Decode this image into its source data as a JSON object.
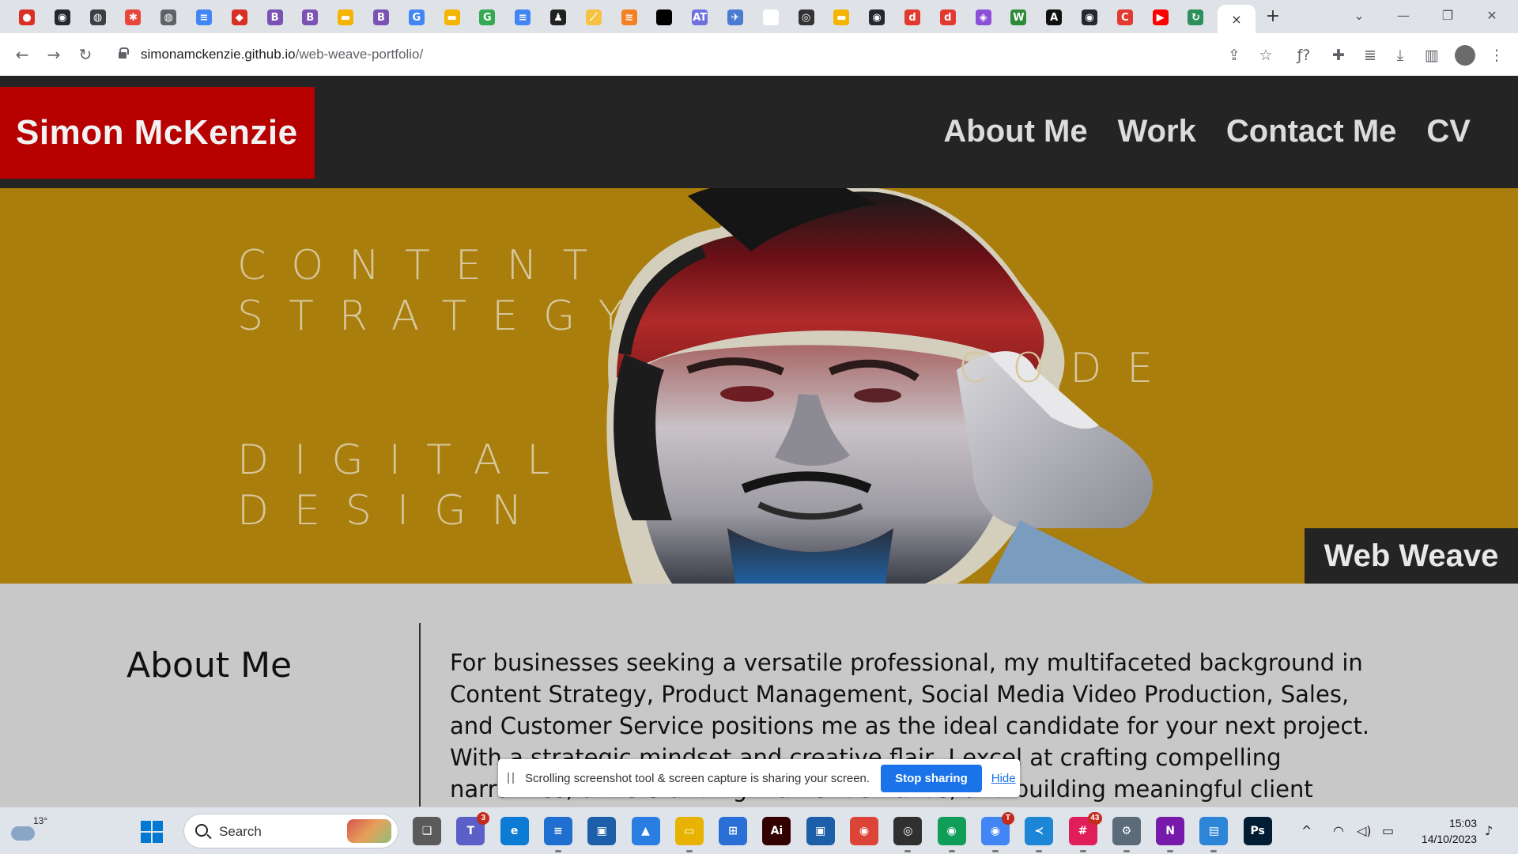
{
  "browser": {
    "tabs": [
      {
        "icon": "record-icon",
        "color": "#d93025",
        "glyph": "●"
      },
      {
        "icon": "github-icon",
        "color": "#24292f",
        "glyph": "◉"
      },
      {
        "icon": "globe-icon",
        "color": "#3c4043",
        "glyph": "◍"
      },
      {
        "icon": "asterisk-icon",
        "color": "#e8453c",
        "glyph": "✱"
      },
      {
        "icon": "globe-icon",
        "color": "#5f6368",
        "glyph": "◍"
      },
      {
        "icon": "docs-icon",
        "color": "#4285f4",
        "glyph": "≡"
      },
      {
        "icon": "diamond-icon",
        "color": "#d93025",
        "glyph": "◆"
      },
      {
        "icon": "bootstrap-icon",
        "color": "#7952b3",
        "glyph": "B"
      },
      {
        "icon": "bootstrap-icon",
        "color": "#7952b3",
        "glyph": "B"
      },
      {
        "icon": "slides-icon",
        "color": "#f4b400",
        "glyph": "▬"
      },
      {
        "icon": "bootstrap-icon",
        "color": "#7952b3",
        "glyph": "B"
      },
      {
        "icon": "google-icon",
        "color": "#4285f4",
        "glyph": "G"
      },
      {
        "icon": "slides-icon",
        "color": "#f4b400",
        "glyph": "▬"
      },
      {
        "icon": "google-icon",
        "color": "#34a853",
        "glyph": "G"
      },
      {
        "icon": "docs-icon",
        "color": "#4285f4",
        "glyph": "≡"
      },
      {
        "icon": "person-icon",
        "color": "#222222",
        "glyph": "♟"
      },
      {
        "icon": "feather-icon",
        "color": "#f6c244",
        "glyph": "⟋"
      },
      {
        "icon": "stack-icon",
        "color": "#f48024",
        "glyph": "≋"
      },
      {
        "icon": "apple-icon",
        "color": "#000000",
        "glyph": ""
      },
      {
        "icon": "text-icon",
        "color": "#6f6fe0",
        "glyph": "AT"
      },
      {
        "icon": "tools-icon",
        "color": "#4a7bd0",
        "glyph": "✈"
      },
      {
        "icon": "blank-icon",
        "color": "#ffffff",
        "glyph": ""
      },
      {
        "icon": "openai-icon",
        "color": "#333333",
        "glyph": "◎"
      },
      {
        "icon": "slides-icon",
        "color": "#f4b400",
        "glyph": "▬"
      },
      {
        "icon": "github-icon",
        "color": "#24292f",
        "glyph": "◉"
      },
      {
        "icon": "d-icon",
        "color": "#e33a2f",
        "glyph": "d"
      },
      {
        "icon": "d-icon",
        "color": "#e33a2f",
        "glyph": "d"
      },
      {
        "icon": "camera-icon",
        "color": "#8a4fd6",
        "glyph": "◈"
      },
      {
        "icon": "w-icon",
        "color": "#2e8b3a",
        "glyph": "W"
      },
      {
        "icon": "a-icon",
        "color": "#111111",
        "glyph": "A"
      },
      {
        "icon": "github-icon",
        "color": "#24292f",
        "glyph": "◉"
      },
      {
        "icon": "c-icon",
        "color": "#e33a2f",
        "glyph": "C"
      },
      {
        "icon": "youtube-icon",
        "color": "#ff0000",
        "glyph": "▶"
      },
      {
        "icon": "refresh-icon",
        "color": "#2d8f5a",
        "glyph": "↻"
      }
    ],
    "active_tab_close": "×",
    "new_tab": "+",
    "window_controls": {
      "minimize": "—",
      "restore": "❐",
      "close": "✕",
      "tab_search": "⌄"
    },
    "nav": {
      "back": "←",
      "forward": "→",
      "reload": "↻"
    },
    "address": {
      "host": "simonamckenzie.github.io",
      "path": "/web-weave-portfolio/"
    },
    "toolbar_icons": [
      {
        "name": "share-icon",
        "glyph": "⇪"
      },
      {
        "name": "bookmark-star-icon",
        "glyph": "☆"
      },
      {
        "name": "font-finder-icon",
        "glyph": "ƒ?"
      },
      {
        "name": "extensions-icon",
        "glyph": "✚"
      },
      {
        "name": "reading-list-icon",
        "glyph": "≣"
      },
      {
        "name": "download-icon",
        "glyph": "⤓"
      },
      {
        "name": "side-panel-icon",
        "glyph": "▥"
      }
    ],
    "menu": "⋮"
  },
  "site": {
    "brand": "Simon McKenzie",
    "nav": [
      "About Me",
      "Work",
      "Contact Me",
      "CV"
    ],
    "hero": {
      "words": [
        "CONTENT\nSTRATEGY",
        "CODE",
        "DIGITAL\nDESIGN"
      ],
      "badge": "Web Weave",
      "background": "#aa7e0c"
    },
    "about": {
      "heading": "About Me",
      "body": "For businesses seeking a versatile professional, my multifaceted background in Content Strategy, Product Management, Social Media Video Production, Sales, and Customer Service positions me as the ideal candidate for your next project. With a strategic mindset and creative flair, I excel at crafting compelling narratives, understanding market demands, and building meaningful client relationships."
    }
  },
  "share_notice": {
    "text": "Scrolling screenshot tool & screen capture is sharing your screen.",
    "stop": "Stop sharing",
    "hide": "Hide"
  },
  "taskbar": {
    "weather_temp": "13°",
    "search_label": "Search",
    "apps": [
      {
        "name": "task-view-icon",
        "color": "#5a5a5a",
        "glyph": "❏",
        "state": ""
      },
      {
        "name": "teams-icon",
        "color": "#5b5fc7",
        "glyph": "T",
        "state": "",
        "badge": "3"
      },
      {
        "name": "edge-icon",
        "color": "#0c7bd4",
        "glyph": "e",
        "state": ""
      },
      {
        "name": "notes-app-icon",
        "color": "#1f6fd1",
        "glyph": "≡",
        "state": "running"
      },
      {
        "name": "window-app-icon",
        "color": "#1c5fa8",
        "glyph": "▣",
        "state": ""
      },
      {
        "name": "photos-icon",
        "color": "#2a7de1",
        "glyph": "▲",
        "state": ""
      },
      {
        "name": "file-explorer-icon",
        "color": "#e8b300",
        "glyph": "▭",
        "state": "running"
      },
      {
        "name": "store-icon",
        "color": "#2a6fd6",
        "glyph": "⊞",
        "state": ""
      },
      {
        "name": "illustrator-icon",
        "color": "#330000",
        "glyph": "Ai",
        "state": ""
      },
      {
        "name": "window-app-icon",
        "color": "#1c5fa8",
        "glyph": "▣",
        "state": ""
      },
      {
        "name": "chrome-icon",
        "color": "#db4437",
        "glyph": "◉",
        "state": "focused"
      },
      {
        "name": "obs-icon",
        "color": "#303030",
        "glyph": "◎",
        "state": "running"
      },
      {
        "name": "chrome-icon",
        "color": "#0f9d58",
        "glyph": "◉",
        "state": "running"
      },
      {
        "name": "chrome-icon",
        "color": "#4285f4",
        "glyph": "◉",
        "state": "running",
        "badge": "T"
      },
      {
        "name": "vscode-icon",
        "color": "#1e86d6",
        "glyph": "≺",
        "state": "running"
      },
      {
        "name": "slack-icon",
        "color": "#e01e5a",
        "glyph": "#",
        "state": "running",
        "badge": "43"
      },
      {
        "name": "settings-icon",
        "color": "#5c6b7a",
        "glyph": "⚙",
        "state": "running"
      },
      {
        "name": "onenote-icon",
        "color": "#7719aa",
        "glyph": "N",
        "state": "running"
      },
      {
        "name": "notepad-icon",
        "color": "#2d85d8",
        "glyph": "▤",
        "state": "running"
      },
      {
        "name": "photoshop-icon",
        "color": "#001d34",
        "glyph": "Ps",
        "state": ""
      }
    ],
    "tray": [
      {
        "name": "show-hidden-icons-icon",
        "glyph": "^"
      },
      {
        "name": "wifi-icon",
        "glyph": "◠"
      },
      {
        "name": "volume-icon",
        "glyph": "◁)"
      },
      {
        "name": "battery-icon",
        "glyph": "▭"
      }
    ],
    "time": "15:03",
    "date": "14/10/2023",
    "notification": "♪"
  }
}
